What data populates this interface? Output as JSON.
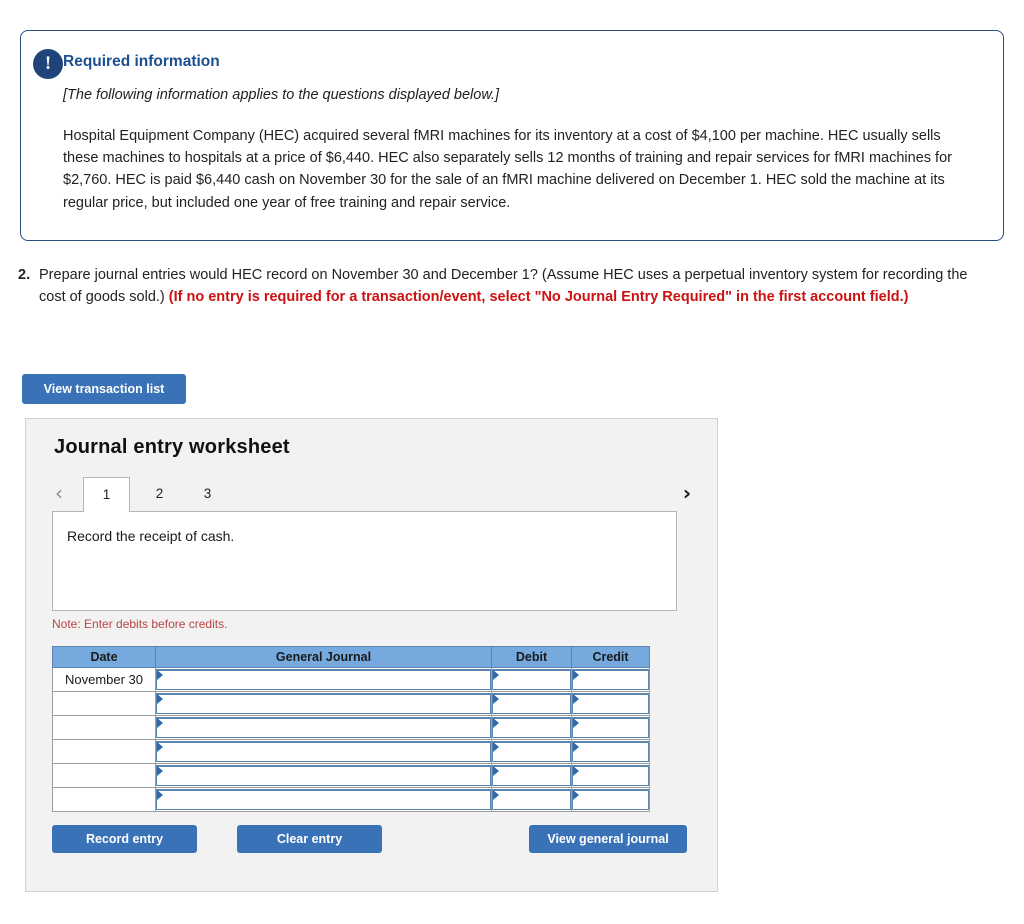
{
  "info": {
    "badge_icon": "exclamation-icon",
    "badge_glyph": "!",
    "title": "Required information",
    "subtitle": "[The following information applies to the questions displayed below.]",
    "body": "Hospital Equipment Company (HEC) acquired several fMRI machines for its inventory at a cost of $4,100 per machine. HEC usually sells these machines to hospitals at a price of $6,440. HEC also separately sells 12 months of training and repair services for fMRI machines for $2,760. HEC is paid $6,440 cash on November 30 for the sale of an fMRI machine delivered on December 1. HEC sold the machine at its regular price, but included one year of free training and repair service.",
    "border_color": "#2a4d82",
    "title_color": "#1a5091",
    "badge_color": "#1f4479"
  },
  "question": {
    "number": "2.",
    "text": "Prepare journal entries would HEC record on November 30 and December 1? (Assume HEC uses a perpetual inventory system for recording the cost of goods sold.) ",
    "requirement_note": "(If no entry is required for a transaction/event, select \"No Journal Entry Required\" in the first account field.)",
    "note_color": "#cc1111"
  },
  "toolbar": {
    "view_transaction_list_label": "View transaction list"
  },
  "worksheet": {
    "title": "Journal entry worksheet",
    "tabs": [
      {
        "label": "1",
        "active": true
      },
      {
        "label": "2",
        "active": false
      },
      {
        "label": "3",
        "active": false
      }
    ],
    "prev_glyph": "‹",
    "next_glyph": "›",
    "description": "Record the receipt of cash.",
    "note": "Note: Enter debits before credits.",
    "note_color": "#bb4444",
    "accent_color": "#3a72b8",
    "header_fill": "#76aade"
  },
  "journal_table": {
    "columns": [
      "Date",
      "General Journal",
      "Debit",
      "Credit"
    ],
    "rows": [
      {
        "date": "November 30",
        "general_journal": "",
        "debit": "",
        "credit": ""
      },
      {
        "date": "",
        "general_journal": "",
        "debit": "",
        "credit": ""
      },
      {
        "date": "",
        "general_journal": "",
        "debit": "",
        "credit": ""
      },
      {
        "date": "",
        "general_journal": "",
        "debit": "",
        "credit": ""
      },
      {
        "date": "",
        "general_journal": "",
        "debit": "",
        "credit": ""
      },
      {
        "date": "",
        "general_journal": "",
        "debit": "",
        "credit": ""
      }
    ]
  },
  "footer": {
    "record_entry_label": "Record entry",
    "clear_entry_label": "Clear entry",
    "view_general_journal_label": "View general journal"
  }
}
